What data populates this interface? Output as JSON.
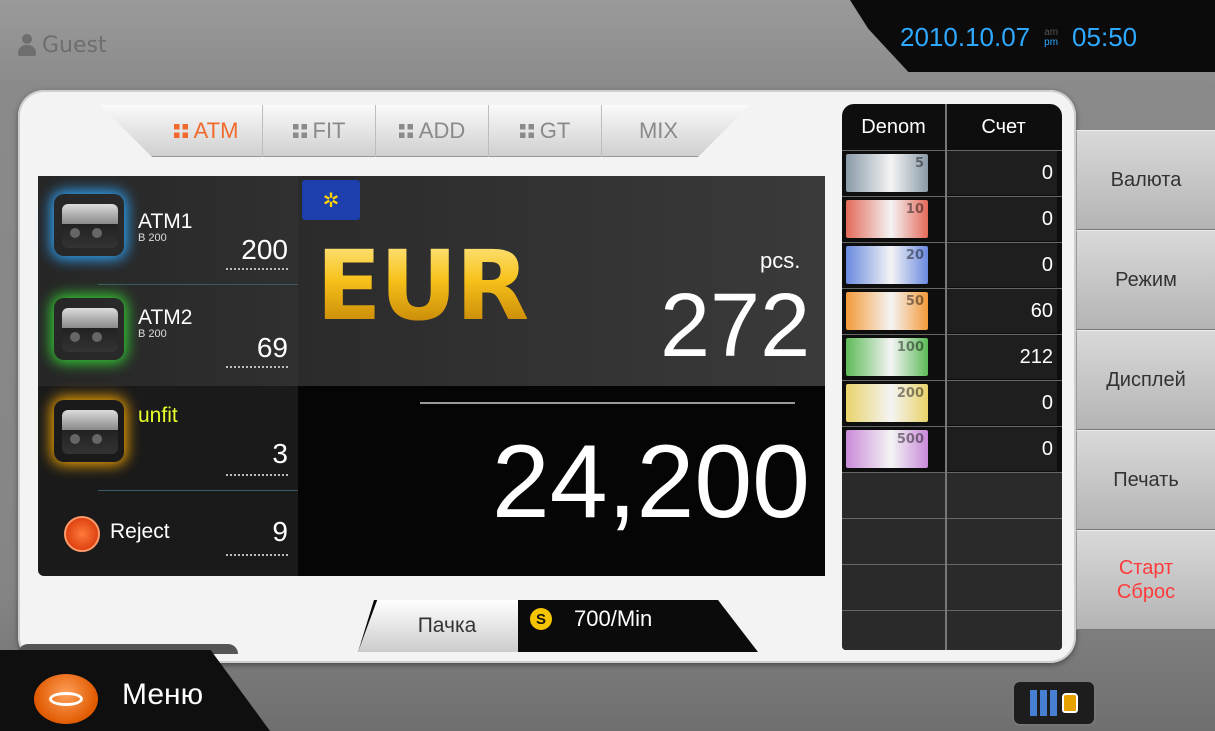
{
  "header": {
    "user": "Guest",
    "date": "2010.10.07",
    "am_label": "am",
    "pm_label": "pm",
    "time": "05:50"
  },
  "tabs": [
    {
      "label": "ATM",
      "active": true
    },
    {
      "label": "FIT",
      "active": false
    },
    {
      "label": "ADD",
      "active": false
    },
    {
      "label": "GT",
      "active": false
    },
    {
      "label": "MIX",
      "active": false
    }
  ],
  "pockets": [
    {
      "name": "ATM1",
      "sub": "B 200",
      "count": "200",
      "glow": "#2fa8ff"
    },
    {
      "name": "ATM2",
      "sub": "B 200",
      "count": "69",
      "glow": "#35d335"
    },
    {
      "name": "unfit",
      "sub": "",
      "count": "3",
      "glow": "#f2a400"
    },
    {
      "name": "Reject",
      "sub": "",
      "count": "9"
    }
  ],
  "currency": {
    "code": "EUR",
    "pcs_label": "pcs.",
    "pcs": "272",
    "amount": "24,200"
  },
  "bottom": {
    "batch_label": "Пачка",
    "speed_icon": "S",
    "speed": "700/Min"
  },
  "denom_table": {
    "header_denom": "Denom",
    "header_count": "Счет",
    "rows": [
      {
        "denom": "5",
        "count": "0",
        "color": "#8a9aa8"
      },
      {
        "denom": "10",
        "count": "0",
        "color": "#e46a5a"
      },
      {
        "denom": "20",
        "count": "0",
        "color": "#6a8ae0"
      },
      {
        "denom": "50",
        "count": "60",
        "color": "#f39a3a"
      },
      {
        "denom": "100",
        "count": "212",
        "color": "#5dbb58"
      },
      {
        "denom": "200",
        "count": "0",
        "color": "#e9d36a"
      },
      {
        "denom": "500",
        "count": "0",
        "color": "#c98ad9"
      }
    ]
  },
  "right_buttons": {
    "currency": "Валюта",
    "mode": "Режим",
    "display": "Дисплей",
    "print": "Печать",
    "start": "Старт",
    "reset": "Сброс"
  },
  "menu": {
    "label": "Меню"
  }
}
